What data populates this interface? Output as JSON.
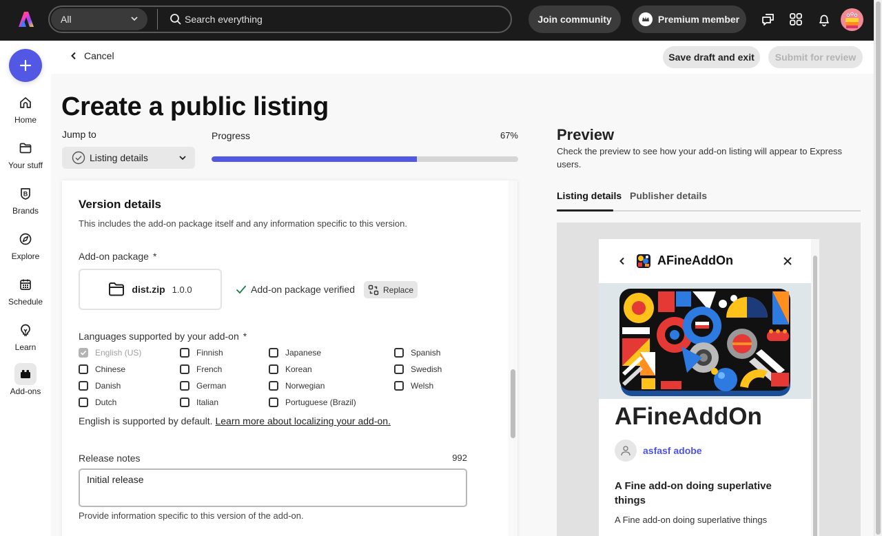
{
  "topbar": {
    "scope_selected": "All",
    "search_placeholder": "Search everything",
    "join_label": "Join community",
    "premium_label": "Premium member",
    "icons": [
      "logo-icon",
      "chat-icon",
      "apps-grid-icon",
      "bell-icon",
      "avatar"
    ]
  },
  "rail": {
    "create_label": "+",
    "items": [
      {
        "label": "Home",
        "icon": "home-icon"
      },
      {
        "label": "Your stuff",
        "icon": "folder-icon"
      },
      {
        "label": "Brands",
        "icon": "brand-icon"
      },
      {
        "label": "Explore",
        "icon": "compass-icon"
      },
      {
        "label": "Schedule",
        "icon": "calendar-icon"
      },
      {
        "label": "Learn",
        "icon": "lightbulb-icon"
      },
      {
        "label": "Add-ons",
        "icon": "addons-icon",
        "active": true
      }
    ]
  },
  "subheader": {
    "cancel_label": "Cancel",
    "save_label": "Save draft and exit",
    "submit_label": "Submit for review"
  },
  "main": {
    "title": "Create a public listing",
    "jump_label": "Jump to",
    "jump_selected": "Listing details",
    "progress_label": "Progress",
    "progress_text": "67%",
    "progress_value": 0.67
  },
  "form": {
    "section_title": "Version details",
    "section_desc": "This includes the add-on package itself and any information specific to this version.",
    "package_label": "Add-on package",
    "required_mark": "*",
    "package_file": "dist.zip",
    "package_version": "1.0.0",
    "verified_text": "Add-on package verified",
    "replace_label": "Replace",
    "languages_label": "Languages supported by your add-on",
    "languages": [
      {
        "name": "English (US)",
        "checked": true,
        "disabled": true
      },
      {
        "name": "Chinese",
        "checked": false
      },
      {
        "name": "Danish",
        "checked": false
      },
      {
        "name": "Dutch",
        "checked": false
      },
      {
        "name": "Finnish",
        "checked": false
      },
      {
        "name": "French",
        "checked": false
      },
      {
        "name": "German",
        "checked": false
      },
      {
        "name": "Italian",
        "checked": false
      },
      {
        "name": "Japanese",
        "checked": false
      },
      {
        "name": "Korean",
        "checked": false
      },
      {
        "name": "Norwegian",
        "checked": false
      },
      {
        "name": "Portuguese (Brazil)",
        "checked": false
      },
      {
        "name": "Spanish",
        "checked": false
      },
      {
        "name": "Swedish",
        "checked": false
      },
      {
        "name": "Welsh",
        "checked": false
      }
    ],
    "lang_note": "English is supported by default.",
    "lang_link": "Learn more about localizing your add-on.",
    "release_notes_label": "Release notes",
    "release_notes_count": "992",
    "release_notes_value": "Initial release",
    "release_notes_help": "Provide information specific to this version of the add-on."
  },
  "preview": {
    "title": "Preview",
    "desc": "Check the preview to see how your add-on listing will appear to Express users.",
    "tabs": [
      {
        "label": "Listing details",
        "active": true
      },
      {
        "label": "Publisher details",
        "active": false
      }
    ],
    "addon_name": "AFineAddOn",
    "author": "asfasf adobe",
    "tagline": "A Fine add-on doing superlative things",
    "short_desc": "A Fine add-on doing superlative things"
  },
  "colors": {
    "accent": "#5258e4",
    "topbar_bg": "#1b1b1b",
    "verified_green": "#1a7f4b"
  }
}
